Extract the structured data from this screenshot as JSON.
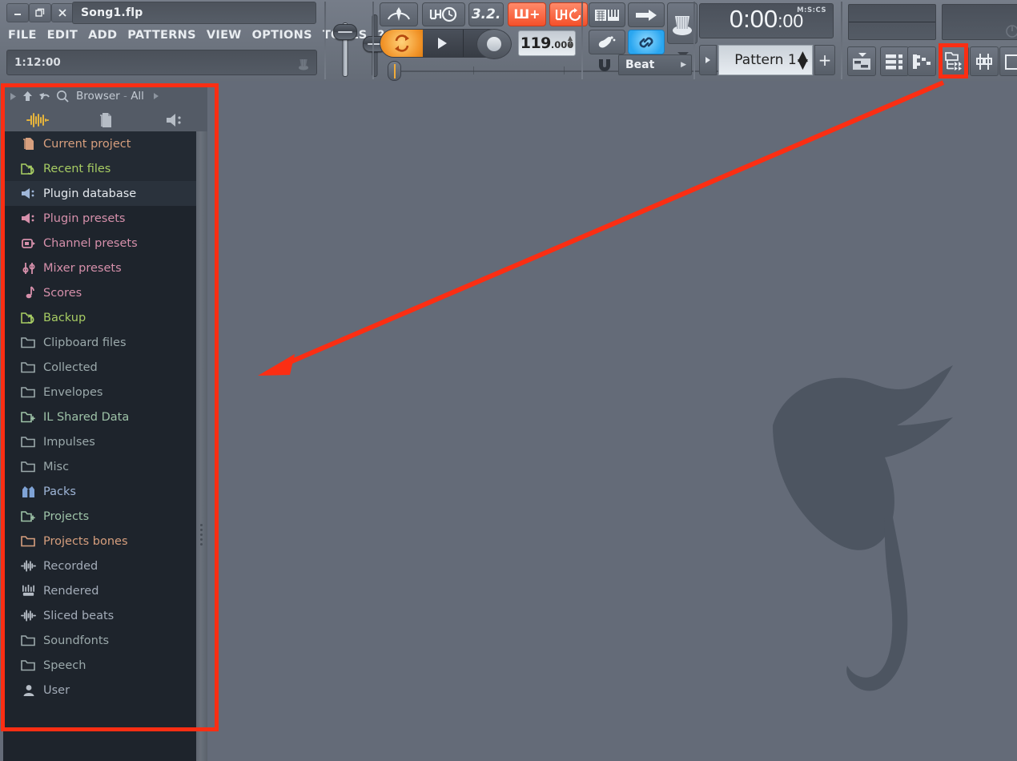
{
  "window": {
    "title": "Song1.flp",
    "minimize_label": "minimize",
    "restore_label": "restore",
    "close_label": "close"
  },
  "menu": {
    "items": [
      {
        "label": "FILE"
      },
      {
        "label": "EDIT"
      },
      {
        "label": "ADD"
      },
      {
        "label": "PATTERNS"
      },
      {
        "label": "VIEW"
      },
      {
        "label": "OPTIONS"
      },
      {
        "label": "TOOLS"
      },
      {
        "label": "?"
      }
    ]
  },
  "hintbar": {
    "value": "1:12:00"
  },
  "transport": {
    "tempo_whole": "119",
    "tempo_frac": ".000",
    "typing_keyboard_icon": "typing-keyboard-icon",
    "step_edit_icon": "step-edit-icon",
    "snap_value_icon": "magnet-icon",
    "snap_label": "Beat",
    "pattern_song_label": "pattern-song-switch",
    "wait_icon": "wait-for-input-icon",
    "countdown_icon": "countdown-before-recording-icon",
    "metronome_value": "3.2.",
    "overlay_notes_label": "Ш+",
    "loop_record_label": "ШΩ",
    "multilink_icon": "multilink-icon"
  },
  "clock": {
    "value_main": "0:00",
    "value_sub": ":00",
    "unit": "M:S:CS"
  },
  "pattern": {
    "name": "Pattern 1",
    "add_label": "+",
    "prev_label": "▸"
  },
  "toolbar_right": {
    "buttons": [
      {
        "name": "playlist-button",
        "icon": "playlist-icon"
      },
      {
        "name": "step-sequencer-button",
        "icon": "step-sequencer-icon"
      },
      {
        "name": "piano-roll-button",
        "icon": "piano-roll-icon"
      },
      {
        "name": "browser-button",
        "icon": "browser-icon",
        "highlighted": true
      },
      {
        "name": "mixer-button",
        "icon": "mixer-icon"
      },
      {
        "name": "plugin-picker-button",
        "icon": "plugin-picker-icon"
      }
    ]
  },
  "browser": {
    "nav": {
      "expand_icon": "triangle-right-icon",
      "up_icon": "arrow-up-icon",
      "back_icon": "undo-arrow-icon",
      "search_icon": "search-icon",
      "title": "Browser",
      "separator": "-",
      "scope": "All",
      "more_icon": "triangle-right-icon"
    },
    "tabs": [
      {
        "name": "browser-tab-waveform",
        "icon": "waveform-icon"
      },
      {
        "name": "browser-tab-files",
        "icon": "file-pages-icon"
      },
      {
        "name": "browser-tab-plugins",
        "icon": "plug-icon"
      }
    ],
    "items": [
      {
        "label": "Current project",
        "icon": "project-file-icon",
        "color": "#d79f7e",
        "icon_color": "#d79f7e",
        "state": "alt"
      },
      {
        "label": "Recent files",
        "icon": "recent-folder-icon",
        "color": "#a7cc63",
        "icon_color": "#a7cc63",
        "state": "alt"
      },
      {
        "label": "Plugin database",
        "icon": "plug-icon",
        "color": "#e6eaef",
        "icon_color": "#9fb6d8",
        "state": "sel"
      },
      {
        "label": "Plugin presets",
        "icon": "plug-icon",
        "color": "#d690ab",
        "icon_color": "#d690ab",
        "state": "normal"
      },
      {
        "label": "Channel presets",
        "icon": "channel-preset-icon",
        "color": "#d690ab",
        "icon_color": "#d690ab",
        "state": "normal"
      },
      {
        "label": "Mixer presets",
        "icon": "mixer-preset-icon",
        "color": "#d690ab",
        "icon_color": "#d690ab",
        "state": "normal"
      },
      {
        "label": "Scores",
        "icon": "note-icon",
        "color": "#d690ab",
        "icon_color": "#d690ab",
        "state": "normal"
      },
      {
        "label": "Backup",
        "icon": "recent-folder-icon",
        "color": "#a7cc63",
        "icon_color": "#a7cc63",
        "state": "normal"
      },
      {
        "label": "Clipboard files",
        "icon": "folder-icon",
        "color": "#9ba9ab",
        "icon_color": "#9ba9ab",
        "state": "normal"
      },
      {
        "label": "Collected",
        "icon": "folder-icon",
        "color": "#9ba9ab",
        "icon_color": "#9ba9ab",
        "state": "normal"
      },
      {
        "label": "Envelopes",
        "icon": "folder-icon",
        "color": "#9ba9ab",
        "icon_color": "#9ba9ab",
        "state": "normal"
      },
      {
        "label": "IL Shared Data",
        "icon": "folder-plus-icon",
        "color": "#9ec3a8",
        "icon_color": "#9ec3a8",
        "state": "normal"
      },
      {
        "label": "Impulses",
        "icon": "folder-icon",
        "color": "#9ba9ab",
        "icon_color": "#9ba9ab",
        "state": "normal"
      },
      {
        "label": "Misc",
        "icon": "folder-icon",
        "color": "#9ba9ab",
        "icon_color": "#9ba9ab",
        "state": "normal"
      },
      {
        "label": "Packs",
        "icon": "packs-icon",
        "color": "#9fb6d8",
        "icon_color": "#7fa3d6",
        "state": "normal"
      },
      {
        "label": "Projects",
        "icon": "folder-plus-icon",
        "color": "#9ec3a8",
        "icon_color": "#9ec3a8",
        "state": "normal"
      },
      {
        "label": "Projects bones",
        "icon": "folder-icon",
        "color": "#d79f7e",
        "icon_color": "#d79f7e",
        "state": "normal"
      },
      {
        "label": "Recorded",
        "icon": "waveform-icon",
        "color": "#a3acb8",
        "icon_color": "#b6bdc6",
        "state": "normal"
      },
      {
        "label": "Rendered",
        "icon": "rendered-icon",
        "color": "#a3acb8",
        "icon_color": "#b6bdc6",
        "state": "normal"
      },
      {
        "label": "Sliced beats",
        "icon": "waveform-icon",
        "color": "#a3acb8",
        "icon_color": "#b6bdc6",
        "state": "normal"
      },
      {
        "label": "Soundfonts",
        "icon": "folder-icon",
        "color": "#9ba9ab",
        "icon_color": "#9ba9ab",
        "state": "normal"
      },
      {
        "label": "Speech",
        "icon": "folder-icon",
        "color": "#9ba9ab",
        "icon_color": "#9ba9ab",
        "state": "normal"
      },
      {
        "label": "User",
        "icon": "user-icon",
        "color": "#a3acb8",
        "icon_color": "#b6bdc6",
        "state": "normal"
      }
    ]
  },
  "annotations": {
    "highlight_color": "#fb2e13",
    "arrow_from_label": "browser-toolbar-button",
    "arrow_to_label": "browser-panel"
  },
  "colors": {
    "app_background": "#646b78",
    "browser_background": "#1e242c",
    "toolbar_background": "#6d747f",
    "accent_orange": "#f2952a",
    "accent_red": "#f4502a",
    "accent_blue": "#2aa6f0"
  }
}
